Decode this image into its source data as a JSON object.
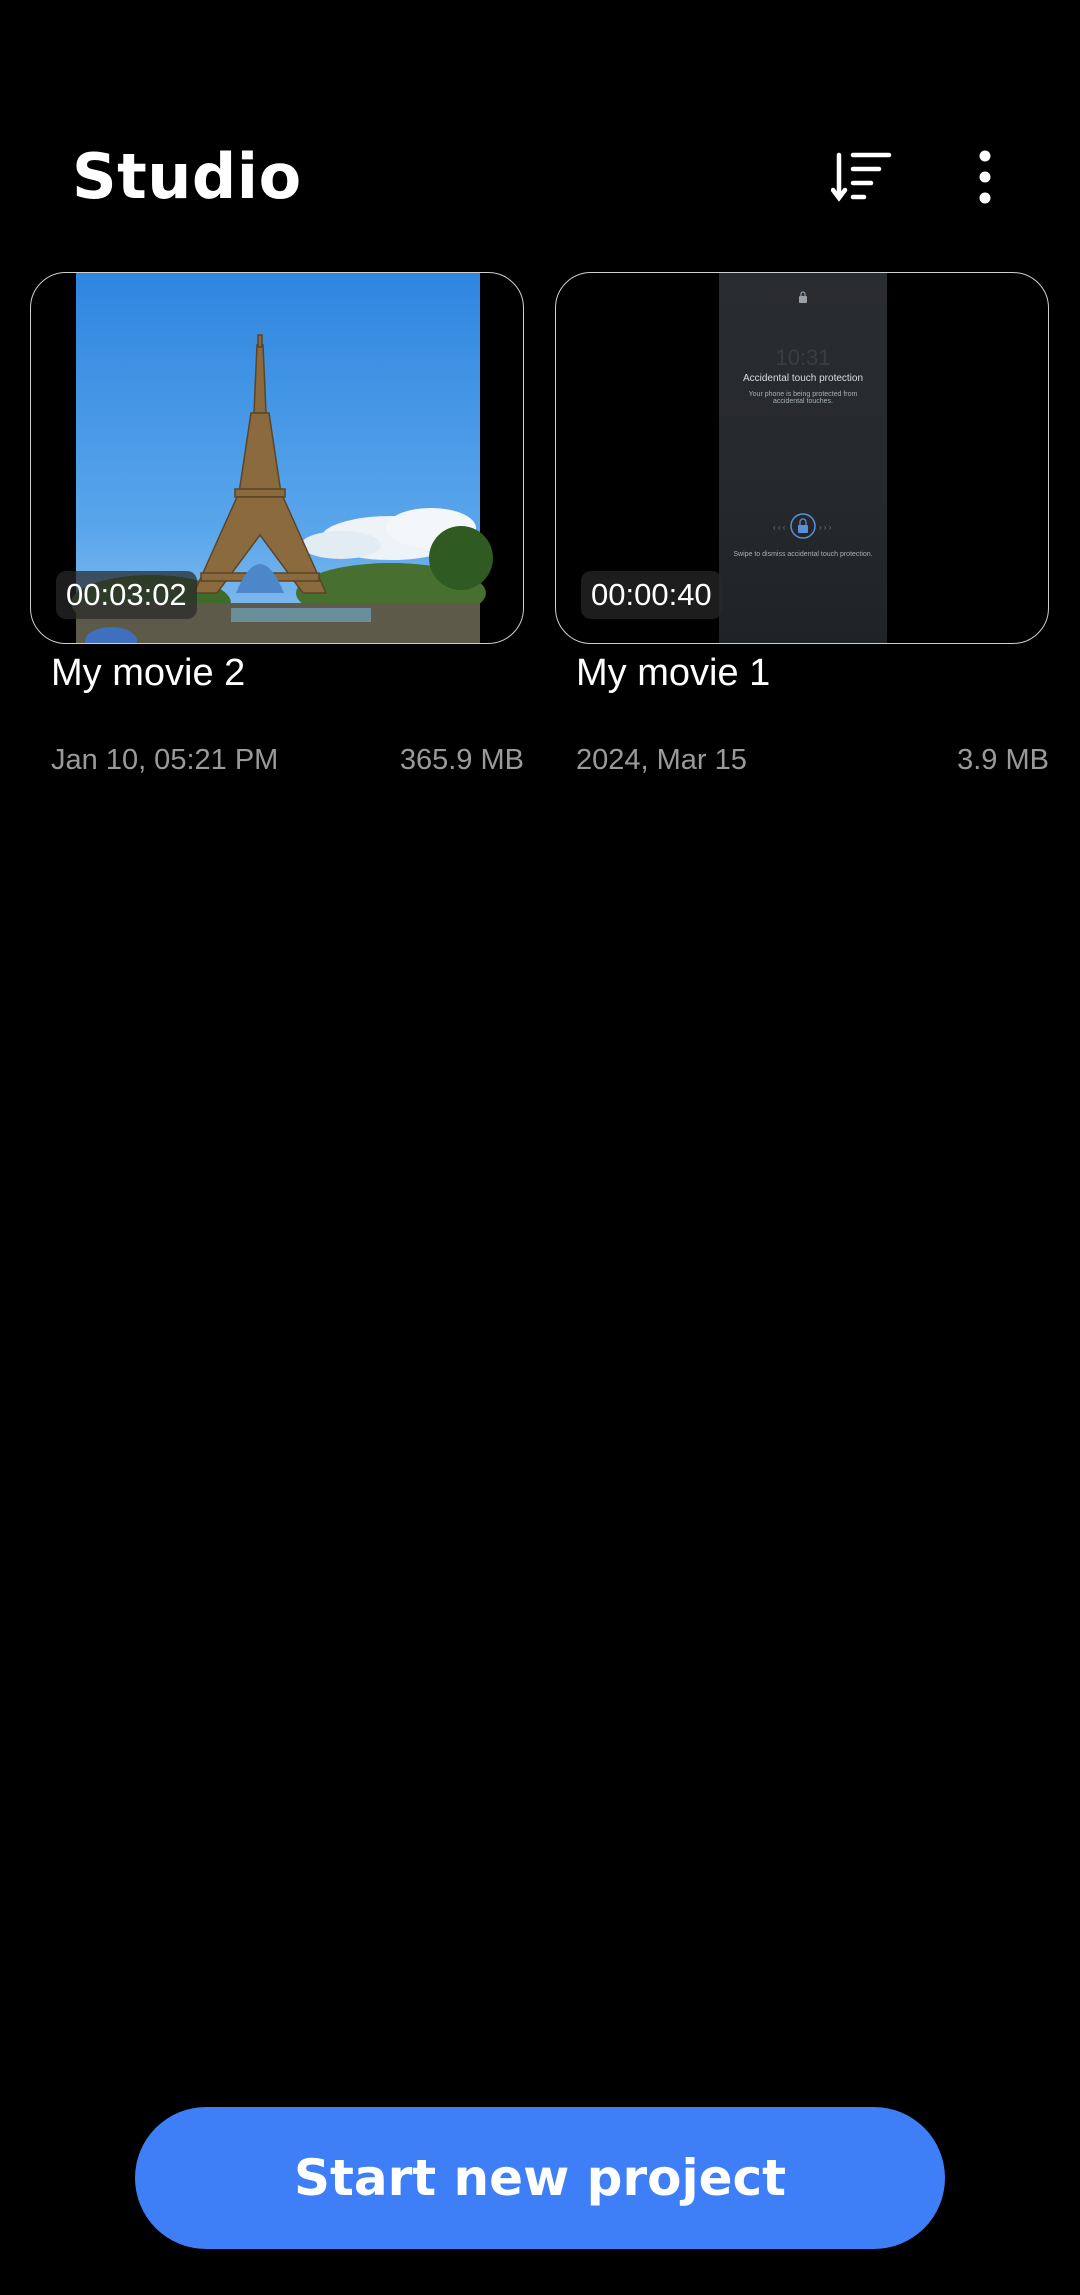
{
  "header": {
    "title": "Studio",
    "sort_icon": "sort-icon",
    "more_icon": "more-vert-icon"
  },
  "projects": [
    {
      "title": "My movie 2",
      "duration": "00:03:02",
      "date": "Jan 10, 05:21 PM",
      "size": "365.9 MB"
    },
    {
      "title": "My movie 1",
      "duration": "00:00:40",
      "date": "2024, Mar 15",
      "size": "3.9 MB",
      "preview": {
        "time": "10:31",
        "heading": "Accidental touch protection",
        "body": "Your phone is being protected from accidental touches.",
        "footer": "Swipe to dismiss accidental touch protection."
      }
    }
  ],
  "cta": {
    "label": "Start new project",
    "color": "#3e7ef7"
  }
}
